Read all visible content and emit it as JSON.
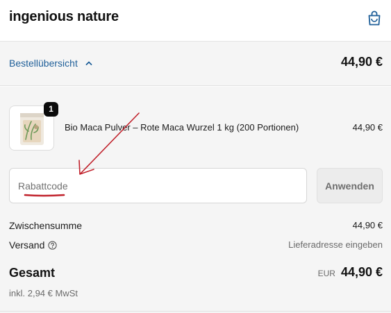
{
  "header": {
    "brand": "ingenious nature",
    "cart_icon": "shopping-bag-icon"
  },
  "summary_bar": {
    "toggle_label": "Bestellübersicht",
    "toggle_icon": "chevron-up-icon",
    "total": "44,90 €"
  },
  "product": {
    "quantity": "1",
    "name": "Bio Maca Pulver – Rote Maca Wurzel 1 kg (200 Portionen)",
    "price": "44,90 €"
  },
  "discount": {
    "placeholder": "Rabattcode",
    "value": "",
    "apply_label": "Anwenden"
  },
  "totals": {
    "subtotal_label": "Zwischensumme",
    "subtotal_value": "44,90 €",
    "shipping_label": "Versand",
    "shipping_value": "Lieferadresse eingeben",
    "total_label": "Gesamt",
    "currency": "EUR",
    "total_value": "44,90 €",
    "tax_note": "inkl. 2,94 € MwSt"
  },
  "colors": {
    "link": "#1f5f99",
    "panel_bg": "#f5f5f5",
    "annotation": "#c0202a",
    "badge_bg": "#0b0b0b"
  }
}
